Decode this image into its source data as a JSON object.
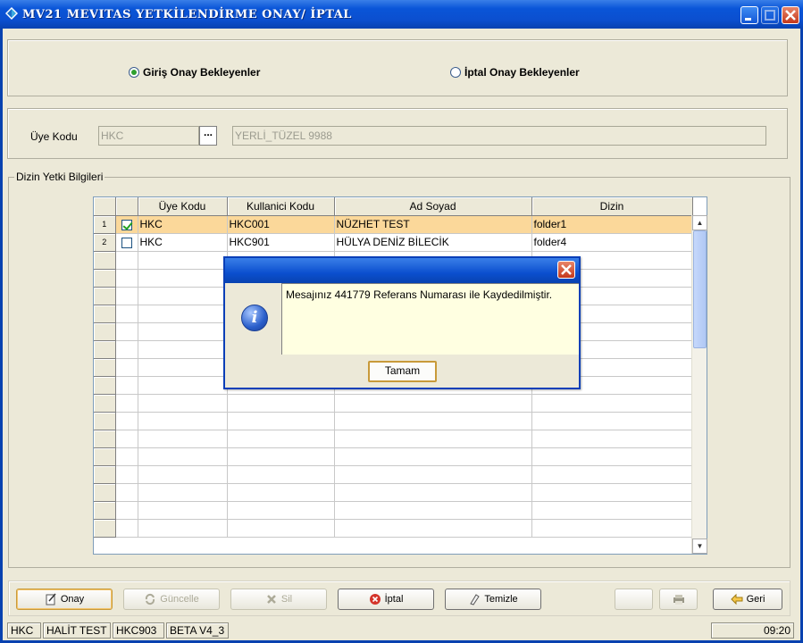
{
  "window": {
    "title": "MV21 MEVITAS YETKİLENDİRME ONAY/ İPTAL"
  },
  "radios": {
    "giris_label": "Giriş Onay Bekleyenler",
    "iptal_label": "İptal Onay Bekleyenler",
    "selected": "giris"
  },
  "member": {
    "label": "Üye Kodu",
    "code_value": "HKC",
    "lookup_button": "...",
    "name_value": "YERLİ_TÜZEL 9988"
  },
  "group": {
    "title": "Dizin Yetki Bilgileri"
  },
  "table": {
    "columns": [
      "",
      "",
      "Üye Kodu",
      "Kullanici Kodu",
      "Ad Soyad",
      "Dizin"
    ],
    "rows": [
      {
        "num": "1",
        "checked": true,
        "uye_kodu": "HKC",
        "kullanici_kodu": "HKC001",
        "ad_soyad": "NÜZHET TEST",
        "dizin": "folder1"
      },
      {
        "num": "2",
        "checked": false,
        "uye_kodu": "HKC",
        "kullanici_kodu": "HKC901",
        "ad_soyad": "HÜLYA DENİZ BİLECİK",
        "dizin": "folder4"
      }
    ]
  },
  "dialog": {
    "message": "Mesajınız 441779 Referans Numarası ile Kaydedilmiştir.",
    "ok_button": "Tamam"
  },
  "buttons": {
    "onay": "Onay",
    "guncelle": "Güncelle",
    "sil": "Sil",
    "iptal": "İptal",
    "temizle": "Temizle",
    "geri": "Geri"
  },
  "statusbar": {
    "member": "HKC",
    "user_name": "HALİT TEST",
    "user_code": "HKC903",
    "version": "BETA V4_3",
    "time": "09:20"
  },
  "colors": {
    "title_blue": "#0b4fcf",
    "selected_row": "#fbd89a",
    "message_bg": "#ffffe1"
  }
}
